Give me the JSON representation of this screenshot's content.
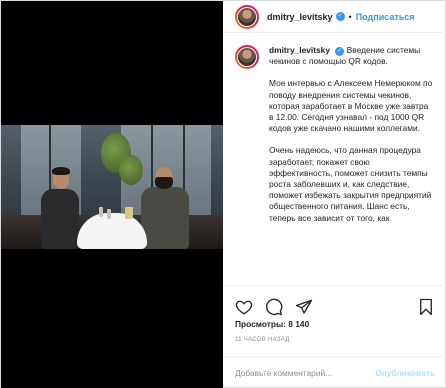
{
  "post": {
    "username": "dmitry_levitsky",
    "verified_glyph": "✓",
    "separator": "•",
    "follow_label": "Подписаться",
    "caption_intro": "Введение системы чекинов с помощью QR кодов.",
    "caption_paragraphs": [
      "Мое интервью с Алексеем Немерюком по поводу внедрения системы чекинов, которая заработает в Москве уже завтра в 12.00. Сегодня узнавал - под 1000 QR кодов уже скачано нашими коллегами.",
      "Очень надеюсь, что данная процедура заработает, покажет свою эффективность, поможет снизить темпы роста заболевших и, как следствие, поможет избежать закрытия предприятий общественного питания. Шанс есть, теперь все зависит от того, как"
    ],
    "views_label": "Просмотры: 8 140",
    "time_label": "11 часов назад"
  },
  "icons": {
    "like": "heart-icon",
    "comment": "comment-icon",
    "share": "share-icon",
    "save": "bookmark-icon",
    "verified": "verified-badge-icon"
  },
  "comment_box": {
    "placeholder": "Добавьте комментарий...",
    "publish_label": "Опубликовать"
  },
  "colors": {
    "accent": "#3897f0",
    "publish_disabled": "#b2dffc",
    "muted": "#8e8e8e"
  }
}
